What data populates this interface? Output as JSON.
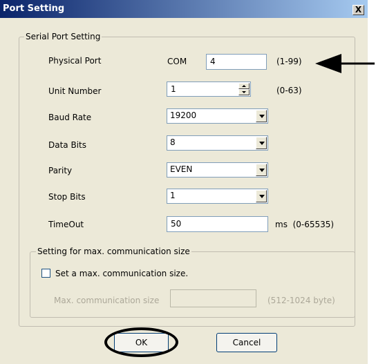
{
  "window": {
    "title": "Port Setting",
    "close_label": "X"
  },
  "serial_group": {
    "legend": "Serial Port Setting",
    "physical_port": {
      "label": "Physical Port",
      "prefix": "COM",
      "value": "4",
      "range": "(1-99)"
    },
    "unit_number": {
      "label": "Unit Number",
      "value": "1",
      "range": "(0-63)"
    },
    "baud_rate": {
      "label": "Baud Rate",
      "value": "19200"
    },
    "data_bits": {
      "label": "Data Bits",
      "value": "8"
    },
    "parity": {
      "label": "Parity",
      "value": "EVEN"
    },
    "stop_bits": {
      "label": "Stop Bits",
      "value": "1"
    },
    "timeout": {
      "label": "TimeOut",
      "value": "50",
      "range": "ms  (0-65535)"
    }
  },
  "max_size_group": {
    "legend": "Setting for max. communication size",
    "checkbox_label": "Set a max. communication size.",
    "checked": false,
    "size_label": "Max. communication size",
    "size_value": "",
    "size_range": "(512-1024 byte)"
  },
  "buttons": {
    "ok": "OK",
    "cancel": "Cancel"
  },
  "colors": {
    "titlebar_start": "#0a246a",
    "titlebar_end": "#a6caf0",
    "dialog_bg": "#ece9d8"
  }
}
